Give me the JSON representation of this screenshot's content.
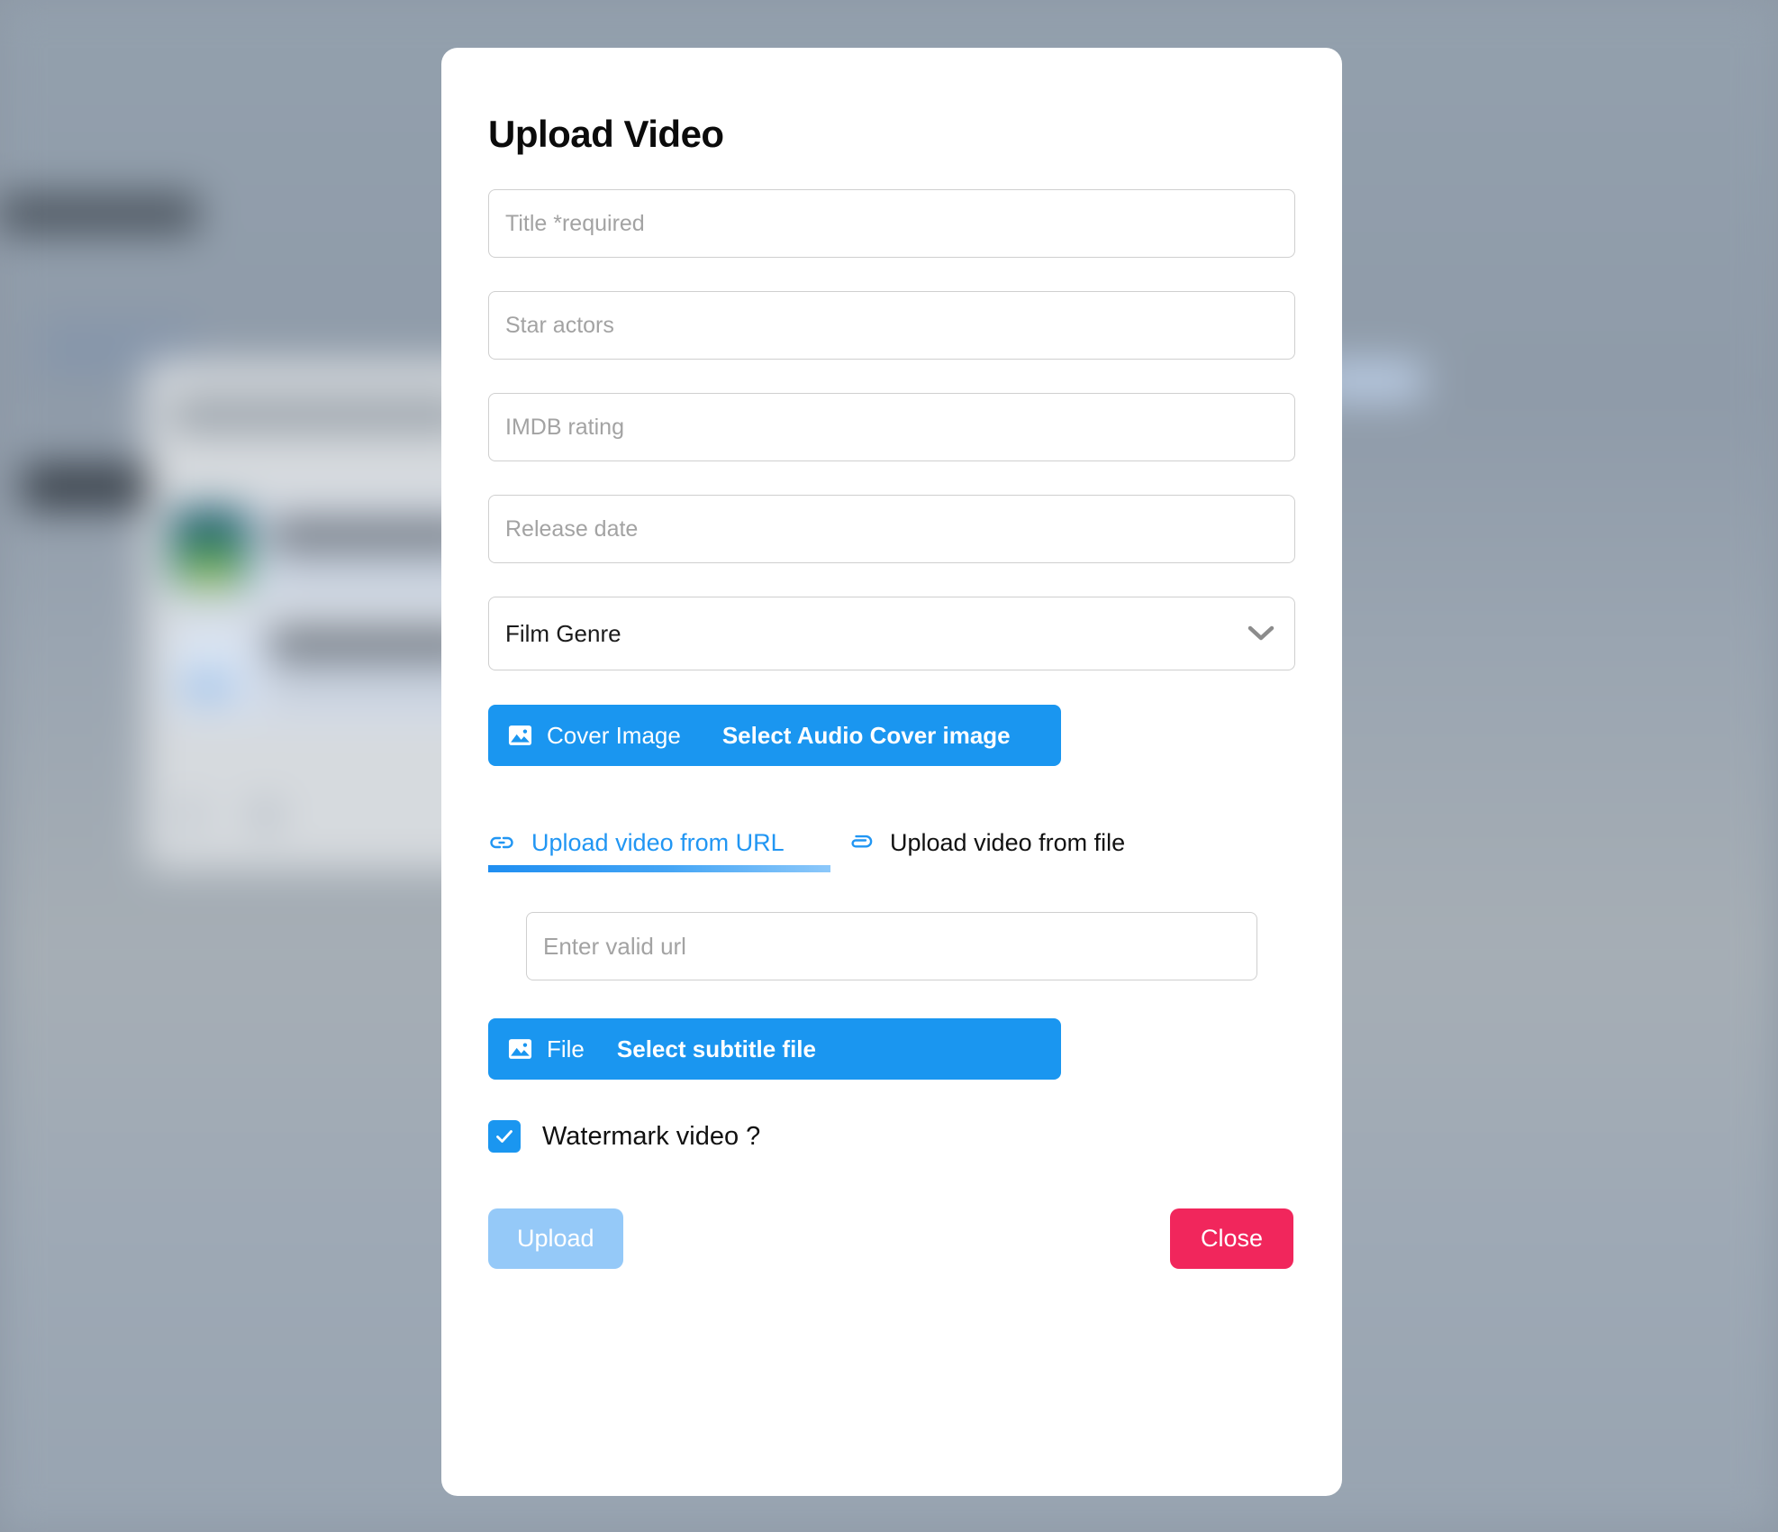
{
  "modal": {
    "title": "Upload Video",
    "fields": [
      {
        "name": "title",
        "placeholder": "Title *required"
      },
      {
        "name": "star_actors",
        "placeholder": "Star actors"
      },
      {
        "name": "imdb_rating",
        "placeholder": "IMDB rating"
      },
      {
        "name": "release_date",
        "placeholder": "Release date"
      }
    ],
    "genre_select": {
      "value": "Film Genre",
      "icon": "chevron-down-icon"
    },
    "cover_image_button": {
      "icon": "image-icon",
      "label": "Cover Image",
      "action_label": "Select Audio Cover image"
    },
    "tabs": [
      {
        "label": "Upload video from URL",
        "icon": "link-icon",
        "active": true
      },
      {
        "label": "Upload video from file",
        "icon": "paperclip-icon",
        "active": false
      }
    ],
    "url_input": {
      "placeholder": "Enter valid url",
      "value": ""
    },
    "subtitle_file_button": {
      "icon": "image-icon",
      "label": "File",
      "action_label": "Select subtitle file"
    },
    "watermark_checkbox": {
      "label": "Watermark video ?",
      "checked": true,
      "icon": "check-icon"
    },
    "footer": {
      "upload_label": "Upload",
      "close_label": "Close"
    }
  },
  "colors": {
    "accent_blue": "#1a96f0",
    "tab_active_blue": "#2196f3",
    "close_pink": "#f1265c",
    "upload_disabled_blue": "#95c9f8",
    "overlay": "#8e99a6"
  }
}
